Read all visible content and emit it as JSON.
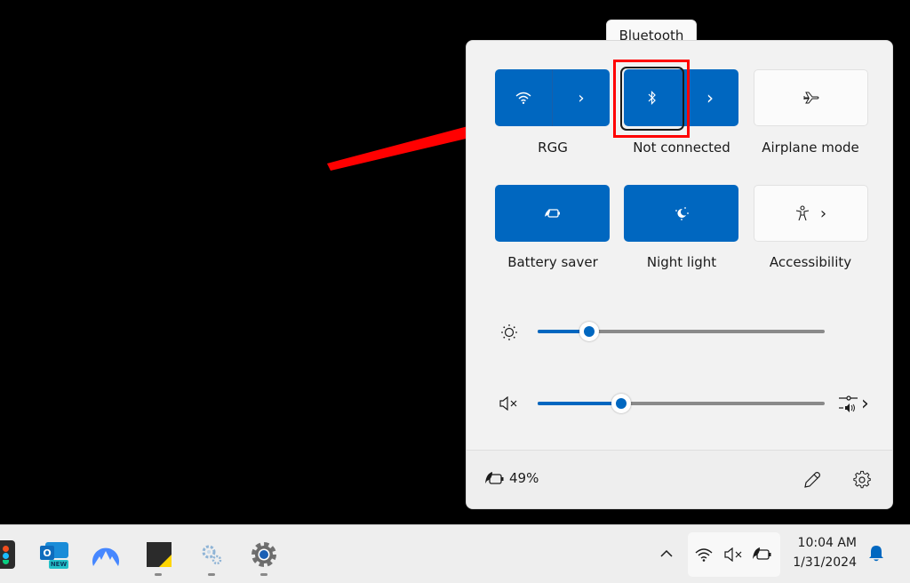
{
  "tooltip": {
    "text": "Bluetooth"
  },
  "quick_settings": {
    "tiles": [
      {
        "name": "wifi",
        "label": "RGG",
        "state": "on",
        "icon": "wifi-icon",
        "has_chevron": true
      },
      {
        "name": "bluetooth",
        "label": "Not connected",
        "state": "on",
        "icon": "bluetooth-icon",
        "has_chevron": true
      },
      {
        "name": "airplane-mode",
        "label": "Airplane mode",
        "state": "off",
        "icon": "airplane-icon",
        "has_chevron": false
      },
      {
        "name": "battery-saver",
        "label": "Battery saver",
        "state": "on",
        "icon": "battery-saver-icon",
        "has_chevron": false
      },
      {
        "name": "night-light",
        "label": "Night light",
        "state": "on",
        "icon": "night-light-icon",
        "has_chevron": false
      },
      {
        "name": "accessibility",
        "label": "Accessibility",
        "state": "off",
        "icon": "accessibility-icon",
        "has_chevron": true
      }
    ],
    "brightness": {
      "icon": "brightness-icon",
      "value_percent": 18
    },
    "volume": {
      "icon": "volume-muted-icon",
      "value_percent": 29,
      "mixer_icon": "audio-mixer-icon"
    },
    "footer": {
      "battery_icon": "battery-saver-charging-icon",
      "battery_percent": "49%",
      "edit_icon": "pencil-icon",
      "settings_icon": "gear-icon"
    }
  },
  "colors": {
    "accent": "#0067c0",
    "annotation": "#ff0000",
    "panel_bg": "#f2f2f2",
    "taskbar_bg": "#eeeeee"
  },
  "taskbar": {
    "apps": [
      {
        "name": "figma",
        "icon": "figma-icon",
        "running": false
      },
      {
        "name": "outlook-new",
        "icon": "outlook-new-icon",
        "badge": "NEW",
        "running": false
      },
      {
        "name": "nordvpn",
        "icon": "nordvpn-icon",
        "running": false
      },
      {
        "name": "sticky-notes",
        "icon": "sticky-notes-icon",
        "running": true
      },
      {
        "name": "system-settings-gears",
        "icon": "gears-icon",
        "running": true
      },
      {
        "name": "settings",
        "icon": "settings-icon",
        "running": true
      }
    ],
    "tray": {
      "overflow_icon": "chevron-up-icon",
      "wifi_icon": "wifi-icon",
      "volume_icon": "volume-muted-icon",
      "battery_icon": "battery-saver-charging-icon"
    },
    "clock": {
      "time": "10:04 AM",
      "date": "1/31/2024"
    },
    "notification_icon": "bell-icon"
  }
}
